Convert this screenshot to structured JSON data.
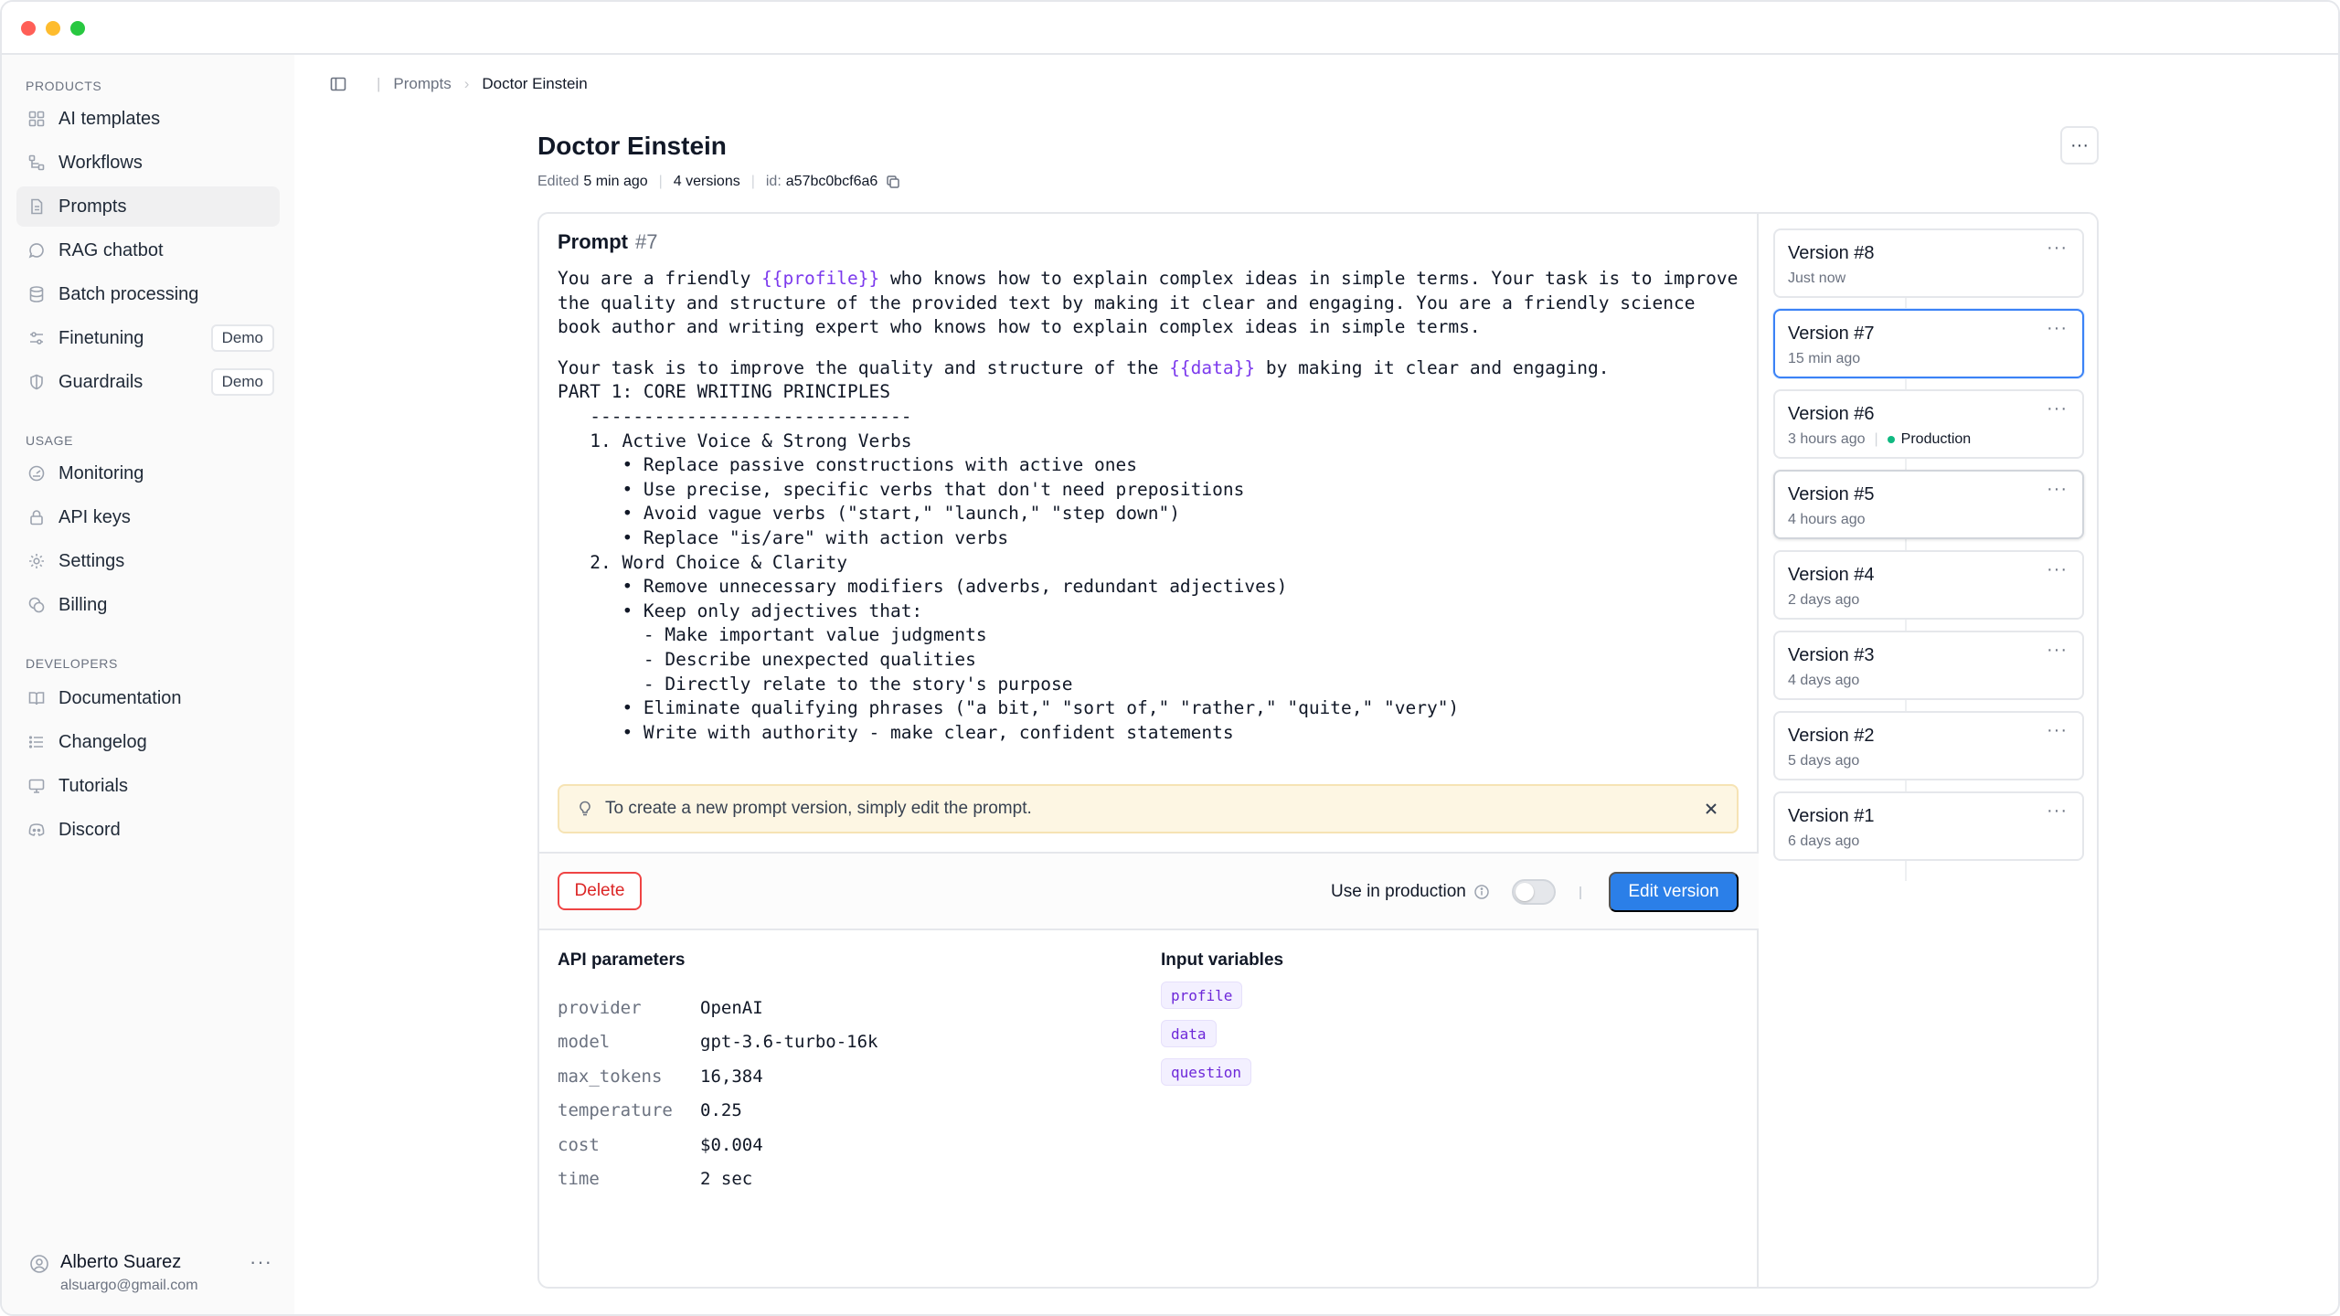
{
  "sidebar": {
    "sections": {
      "products": "PRODUCTS",
      "usage": "USAGE",
      "developers": "DEVELOPERS"
    },
    "products": [
      {
        "label": "AI templates",
        "icon": "grid-icon"
      },
      {
        "label": "Workflows",
        "icon": "workflow-icon"
      },
      {
        "label": "Prompts",
        "icon": "document-icon",
        "active": true
      },
      {
        "label": "RAG chatbot",
        "icon": "chat-icon"
      },
      {
        "label": "Batch processing",
        "icon": "database-icon"
      },
      {
        "label": "Finetuning",
        "icon": "sliders-icon",
        "badge": "Demo"
      },
      {
        "label": "Guardrails",
        "icon": "shield-icon",
        "badge": "Demo"
      }
    ],
    "usage": [
      {
        "label": "Monitoring",
        "icon": "gauge-icon"
      },
      {
        "label": "API keys",
        "icon": "lock-icon"
      },
      {
        "label": "Settings",
        "icon": "gear-icon"
      },
      {
        "label": "Billing",
        "icon": "coins-icon"
      }
    ],
    "developers": [
      {
        "label": "Documentation",
        "icon": "book-icon"
      },
      {
        "label": "Changelog",
        "icon": "list-icon"
      },
      {
        "label": "Tutorials",
        "icon": "monitor-icon"
      },
      {
        "label": "Discord",
        "icon": "discord-icon"
      }
    ],
    "user": {
      "name": "Alberto Suarez",
      "email": "alsuargo@gmail.com",
      "more": "···"
    }
  },
  "breadcrumb": {
    "parent": "Prompts",
    "current": "Doctor Einstein"
  },
  "page": {
    "title": "Doctor Einstein",
    "edited_label": "Edited",
    "edited_value": "5 min ago",
    "versions_count": "4 versions",
    "id_label": "id:",
    "id_value": "a57bc0bcf6a6",
    "more": "···"
  },
  "prompt": {
    "heading": "Prompt",
    "number": "#7",
    "para1": {
      "pre": "You are a friendly ",
      "var": "{{profile}}",
      "post": " who knows how to explain complex ideas in simple terms. Your task is to improve the quality and structure of the provided text by making it clear and engaging. You are a friendly science book author and writing expert who knows how to explain complex ideas in simple terms."
    },
    "para2": {
      "pre": "Your task is to improve the quality and structure of the ",
      "var": "{{data}}",
      "post": " by making it clear and engaging."
    },
    "body": "PART 1: CORE WRITING PRINCIPLES\n   ------------------------------\n   1. Active Voice & Strong Verbs\n      • Replace passive constructions with active ones\n      • Use precise, specific verbs that don't need prepositions\n      • Avoid vague verbs (\"start,\" \"launch,\" \"step down\")\n      • Replace \"is/are\" with action verbs\n   2. Word Choice & Clarity\n      • Remove unnecessary modifiers (adverbs, redundant adjectives)\n      • Keep only adjectives that:\n        - Make important value judgments\n        - Describe unexpected qualities\n        - Directly relate to the story's purpose\n      • Eliminate qualifying phrases (\"a bit,\" \"sort of,\" \"rather,\" \"quite,\" \"very\")\n      • Write with authority - make clear, confident statements",
    "hint": "To create a new prompt version, simply edit the prompt."
  },
  "actions": {
    "delete": "Delete",
    "use_in_production": "Use in production",
    "use_in_production_on": false,
    "edit": "Edit version"
  },
  "api_parameters": {
    "heading": "API parameters",
    "rows": [
      {
        "key": "provider",
        "value": "OpenAI"
      },
      {
        "key": "model",
        "value": "gpt-3.6-turbo-16k"
      },
      {
        "key": "max_tokens",
        "value": "16,384"
      },
      {
        "key": "temperature",
        "value": "0.25"
      },
      {
        "key": "cost",
        "value": "$0.004"
      },
      {
        "key": "time",
        "value": "2 sec"
      }
    ]
  },
  "input_variables": {
    "heading": "Input variables",
    "items": [
      "profile",
      "data",
      "question"
    ]
  },
  "versions": [
    {
      "title": "Version #8",
      "time": "Just now"
    },
    {
      "title": "Version #7",
      "time": "15 min ago",
      "selected": true
    },
    {
      "title": "Version #6",
      "time": "3 hours ago",
      "status": "Production"
    },
    {
      "title": "Version #5",
      "time": "4 hours ago",
      "hover": true
    },
    {
      "title": "Version #4",
      "time": "2 days ago"
    },
    {
      "title": "Version #3",
      "time": "4 days ago"
    },
    {
      "title": "Version #2",
      "time": "5 days ago"
    },
    {
      "title": "Version #1",
      "time": "6 days ago"
    }
  ],
  "colors": {
    "accent": "#2b7fe8",
    "danger": "#dc2626",
    "variable": "#7c3aed",
    "production_dot": "#10b981",
    "hint_bg": "#fdf6e3"
  }
}
